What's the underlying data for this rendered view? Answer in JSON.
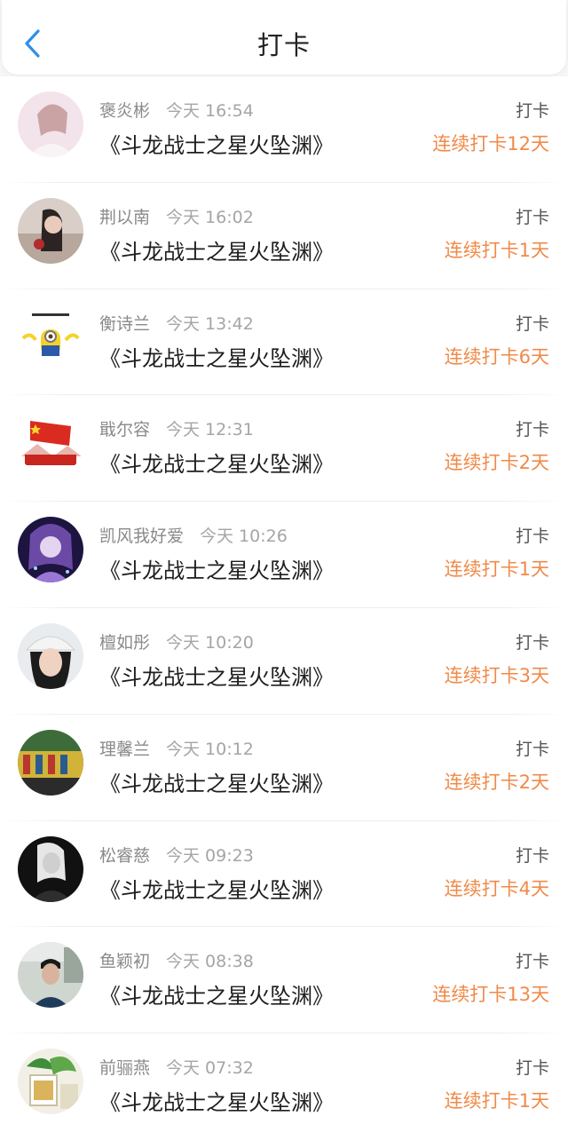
{
  "header": {
    "title": "打卡",
    "back_icon": "chevron-left-icon",
    "accent": "#2f8fe9"
  },
  "colors": {
    "streak": "#f08a49",
    "name": "#8a8a8a",
    "book": "#1e1e1e"
  },
  "checkins": [
    {
      "name": "褒炎彬",
      "time": "今天 16:54",
      "book": "《斗龙战士之星火坠渊》",
      "action": "打卡",
      "streak": "连续打卡12天"
    },
    {
      "name": "荆以南",
      "time": "今天 16:02",
      "book": "《斗龙战士之星火坠渊》",
      "action": "打卡",
      "streak": "连续打卡1天"
    },
    {
      "name": "衡诗兰",
      "time": "今天 13:42",
      "book": "《斗龙战士之星火坠渊》",
      "action": "打卡",
      "streak": "连续打卡6天"
    },
    {
      "name": "戢尔容",
      "time": "今天 12:31",
      "book": "《斗龙战士之星火坠渊》",
      "action": "打卡",
      "streak": "连续打卡2天"
    },
    {
      "name": "凯风我好爱",
      "time": "今天 10:26",
      "book": "《斗龙战士之星火坠渊》",
      "action": "打卡",
      "streak": "连续打卡1天"
    },
    {
      "name": "檀如彤",
      "time": "今天 10:20",
      "book": "《斗龙战士之星火坠渊》",
      "action": "打卡",
      "streak": "连续打卡3天"
    },
    {
      "name": "理馨兰",
      "time": "今天 10:12",
      "book": "《斗龙战士之星火坠渊》",
      "action": "打卡",
      "streak": "连续打卡2天"
    },
    {
      "name": "松睿慈",
      "time": "今天 09:23",
      "book": "《斗龙战士之星火坠渊》",
      "action": "打卡",
      "streak": "连续打卡4天"
    },
    {
      "name": "鱼颖初",
      "time": "今天 08:38",
      "book": "《斗龙战士之星火坠渊》",
      "action": "打卡",
      "streak": "连续打卡13天"
    },
    {
      "name": "前骊燕",
      "time": "今天 07:32",
      "book": "《斗龙战士之星火坠渊》",
      "action": "打卡",
      "streak": "连续打卡1天"
    }
  ]
}
